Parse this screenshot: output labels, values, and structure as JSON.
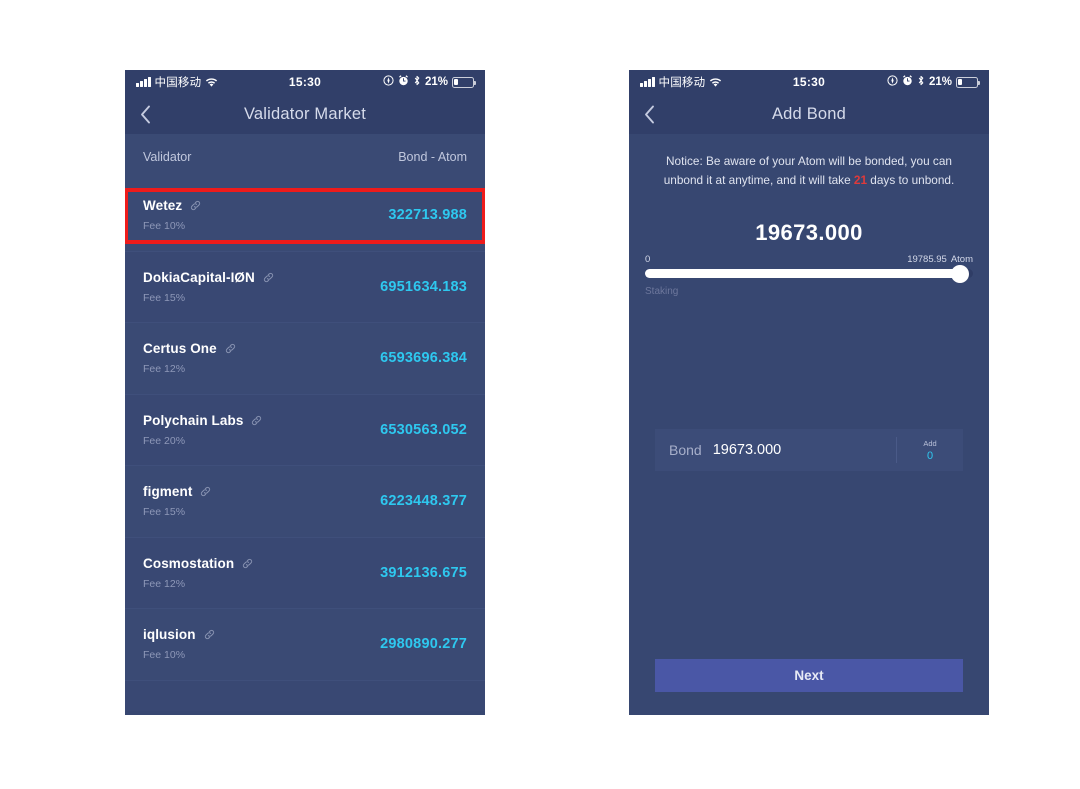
{
  "left_phone": {
    "status_bar": {
      "carrier": "中国移动",
      "time": "15:30",
      "battery_percent": "21%",
      "icons": [
        "signal-bars-icon",
        "wifi-icon",
        "location-icon",
        "alarm-icon",
        "bluetooth-icon",
        "battery-icon"
      ]
    },
    "nav": {
      "back_icon": "chevron-left-icon",
      "title": "Validator Market"
    },
    "list_header": {
      "col_name": "Validator",
      "col_bond": "Bond - Atom"
    },
    "validators": [
      {
        "name": "Wetez",
        "fee": "Fee 10%",
        "bond": "322713.988",
        "highlighted": true
      },
      {
        "name": "DokiaCapital-IØN",
        "fee": "Fee 15%",
        "bond": "6951634.183",
        "highlighted": false
      },
      {
        "name": "Certus One",
        "fee": "Fee 12%",
        "bond": "6593696.384",
        "highlighted": false
      },
      {
        "name": "Polychain Labs",
        "fee": "Fee 20%",
        "bond": "6530563.052",
        "highlighted": false
      },
      {
        "name": "figment",
        "fee": "Fee 15%",
        "bond": "6223448.377",
        "highlighted": false
      },
      {
        "name": "Cosmostation",
        "fee": "Fee 12%",
        "bond": "3912136.675",
        "highlighted": false
      },
      {
        "name": "iqlusion",
        "fee": "Fee 10%",
        "bond": "2980890.277",
        "highlighted": false
      }
    ]
  },
  "right_phone": {
    "status_bar": {
      "carrier": "中国移动",
      "time": "15:30",
      "battery_percent": "21%"
    },
    "nav": {
      "back_icon": "chevron-left-icon",
      "title": "Add Bond"
    },
    "notice": {
      "part1": "Notice: Be aware of your Atom will be bonded, you can unbond it at anytime, and it will take ",
      "days": "21",
      "part2": " days to unbond."
    },
    "amount": "19673.000",
    "slider": {
      "min_label": "0",
      "max_label": "19785.95",
      "unit": "Atom",
      "sub_label": "Staking"
    },
    "bond_row": {
      "label": "Bond",
      "value": "19673.000",
      "add_label": "Add",
      "add_value": "0"
    },
    "next_button": "Next"
  },
  "colors": {
    "phone_bg": "#374771",
    "navbar_bg": "#313f69",
    "row_bg": "#3a4a74",
    "accent_cyan": "#2ec8ef",
    "accent_red": "#ee1b1b",
    "next_button": "#4a57a6"
  }
}
